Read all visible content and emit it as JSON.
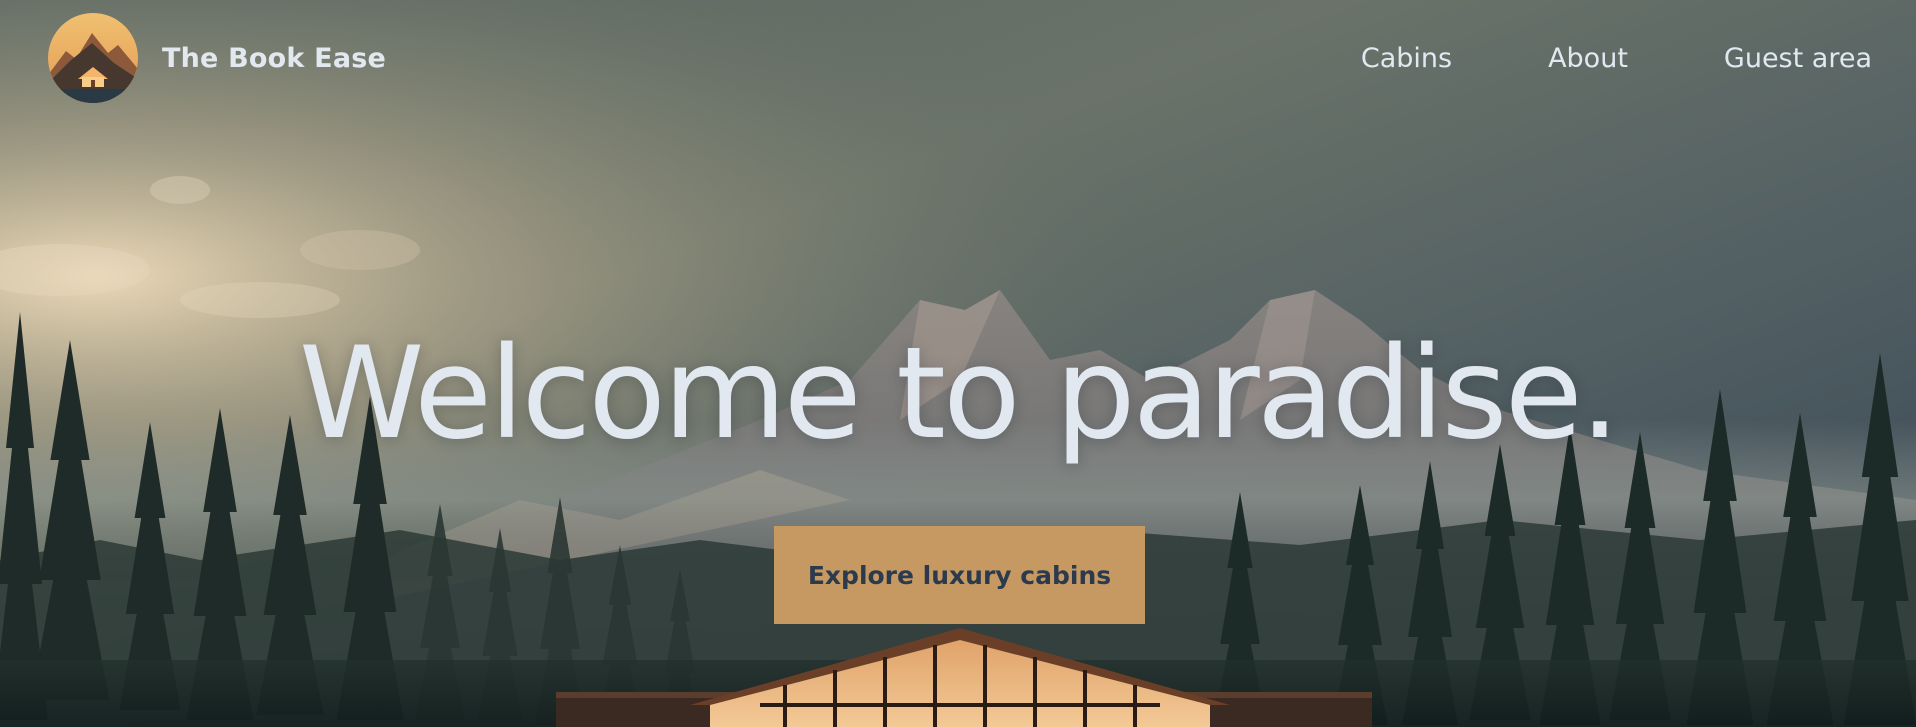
{
  "header": {
    "brand_name": "The Book Ease",
    "logo_icon": "mountain-cabin-logo-icon",
    "nav": [
      {
        "label": "Cabins"
      },
      {
        "label": "About"
      },
      {
        "label": "Guest area"
      }
    ]
  },
  "hero": {
    "title": "Welcome to paradise.",
    "cta_label": "Explore luxury cabins",
    "background": "mountain-forest-cabin-image"
  },
  "colors": {
    "text_light": "#e2e8f0",
    "accent": "#c69963",
    "cta_text": "#2c3a4e"
  }
}
